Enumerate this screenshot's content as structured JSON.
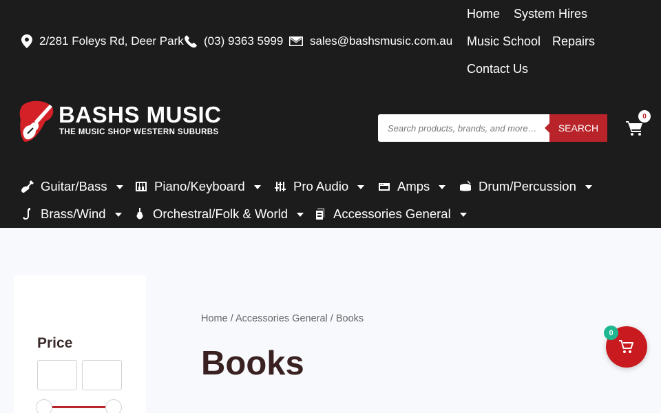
{
  "contact": {
    "address": "2/281 Foleys Rd, Deer Park",
    "phone": "(03) 9363 5999",
    "email": "sales@bashsmusic.com.au"
  },
  "top_links": [
    "Home",
    "System Hires",
    "Music School",
    "Repairs",
    "Contact Us"
  ],
  "logo": {
    "title": "BASHS MUSIC",
    "subtitle": "THE MUSIC SHOP WESTERN SUBURBS"
  },
  "search": {
    "placeholder": "Search products, brands, and more…",
    "button_label": "SEARCH"
  },
  "header_cart": {
    "count": "0"
  },
  "nav": [
    {
      "label": "Guitar/Bass",
      "icon": "guitar-icon"
    },
    {
      "label": "Piano/Keyboard",
      "icon": "piano-icon"
    },
    {
      "label": "Pro Audio",
      "icon": "mixer-sliders-icon"
    },
    {
      "label": "Amps",
      "icon": "amp-icon"
    },
    {
      "label": "Drum/Percussion",
      "icon": "drum-icon"
    },
    {
      "label": "Brass/Wind",
      "icon": "saxophone-icon"
    },
    {
      "label": "Orchestral/Folk & World",
      "icon": "violin-icon"
    },
    {
      "label": "Accessories General",
      "icon": "accessories-icon"
    }
  ],
  "sidebar": {
    "price_title": "Price"
  },
  "breadcrumb": {
    "home": "Home",
    "category": "Accessories General",
    "current": "Books",
    "separator": "/"
  },
  "page_title": "Books",
  "floating_cart": {
    "count": "0"
  },
  "colors": {
    "header_bg": "#1c1c1d",
    "accent_red": "#b8242a",
    "badge_green": "#1fb78f",
    "page_bg": "#f7f9fc"
  }
}
